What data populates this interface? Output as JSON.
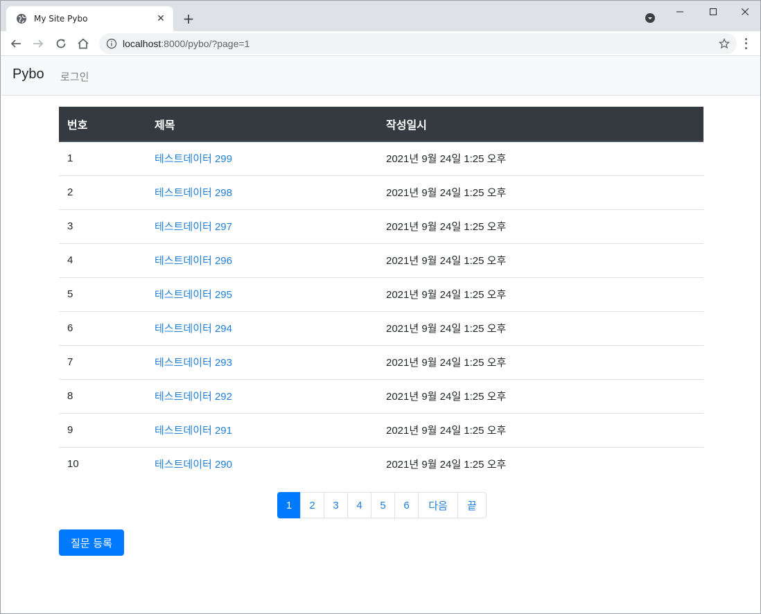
{
  "browser": {
    "tab_title": "My Site Pybo",
    "url_host": "localhost",
    "url_rest": ":8000/pybo/?page=1"
  },
  "site": {
    "brand": "Pybo",
    "login": "로그인"
  },
  "table": {
    "headers": {
      "num": "번호",
      "subject": "제목",
      "date": "작성일시"
    },
    "rows": [
      {
        "num": "1",
        "subject": "테스트데이터 299",
        "date": "2021년 9월 24일 1:25 오후"
      },
      {
        "num": "2",
        "subject": "테스트데이터 298",
        "date": "2021년 9월 24일 1:25 오후"
      },
      {
        "num": "3",
        "subject": "테스트데이터 297",
        "date": "2021년 9월 24일 1:25 오후"
      },
      {
        "num": "4",
        "subject": "테스트데이터 296",
        "date": "2021년 9월 24일 1:25 오후"
      },
      {
        "num": "5",
        "subject": "테스트데이터 295",
        "date": "2021년 9월 24일 1:25 오후"
      },
      {
        "num": "6",
        "subject": "테스트데이터 294",
        "date": "2021년 9월 24일 1:25 오후"
      },
      {
        "num": "7",
        "subject": "테스트데이터 293",
        "date": "2021년 9월 24일 1:25 오후"
      },
      {
        "num": "8",
        "subject": "테스트데이터 292",
        "date": "2021년 9월 24일 1:25 오후"
      },
      {
        "num": "9",
        "subject": "테스트데이터 291",
        "date": "2021년 9월 24일 1:25 오후"
      },
      {
        "num": "10",
        "subject": "테스트데이터 290",
        "date": "2021년 9월 24일 1:25 오후"
      }
    ]
  },
  "pagination": {
    "pages": [
      "1",
      "2",
      "3",
      "4",
      "5",
      "6"
    ],
    "active": "1",
    "next": "다음",
    "last": "끝"
  },
  "actions": {
    "register": "질문 등록"
  },
  "colors": {
    "primary": "#007bff",
    "link": "#1f7ed8",
    "table_header": "#343a40"
  }
}
